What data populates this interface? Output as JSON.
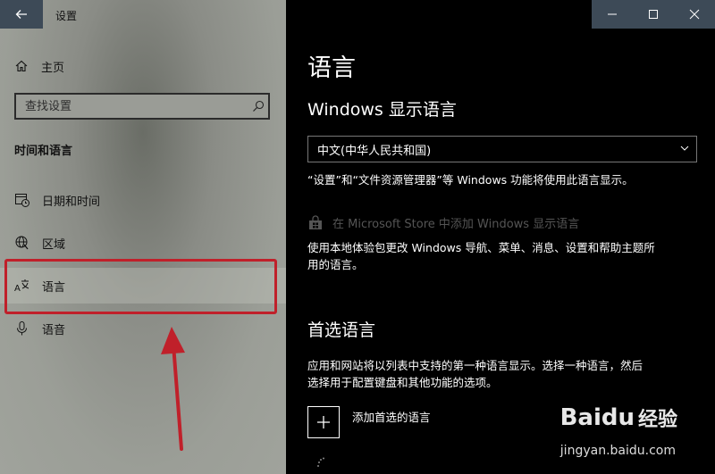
{
  "window": {
    "title": "设置"
  },
  "sidebar": {
    "home_label": "主页",
    "search_placeholder": "查找设置",
    "section_title": "时间和语言",
    "items": [
      {
        "label": "日期和时间",
        "icon": "calendar-clock-icon"
      },
      {
        "label": "区域",
        "icon": "globe-icon"
      },
      {
        "label": "语言",
        "icon": "language-icon",
        "selected": true
      },
      {
        "label": "语音",
        "icon": "microphone-icon"
      }
    ]
  },
  "main": {
    "title": "语言",
    "display_language": {
      "heading": "Windows 显示语言",
      "selected": "中文(中华人民共和国)",
      "description": "“设置”和“文件资源管理器”等 Windows 功能将使用此语言显示。",
      "store_link": "在 Microsoft Store 中添加 Windows 显示语言",
      "store_description_line1": "使用本地体验包更改 Windows 导航、菜单、消息、设置和帮助主题所",
      "store_description_line2": "用的语言。"
    },
    "preferred_languages": {
      "heading": "首选语言",
      "description_line1": "应用和网站将以列表中支持的第一种语言显示。选择一种语言，然后",
      "description_line2": "选择用于配置键盘和其他功能的选项。",
      "add_label": "添加首选的语言"
    }
  },
  "watermark": {
    "brand": "Baidu",
    "cn": "经验",
    "url": "jingyan.baidu.com"
  },
  "colors": {
    "titlebar": "#3d4a57",
    "highlight": "#c0202a",
    "main_bg": "#000000"
  }
}
